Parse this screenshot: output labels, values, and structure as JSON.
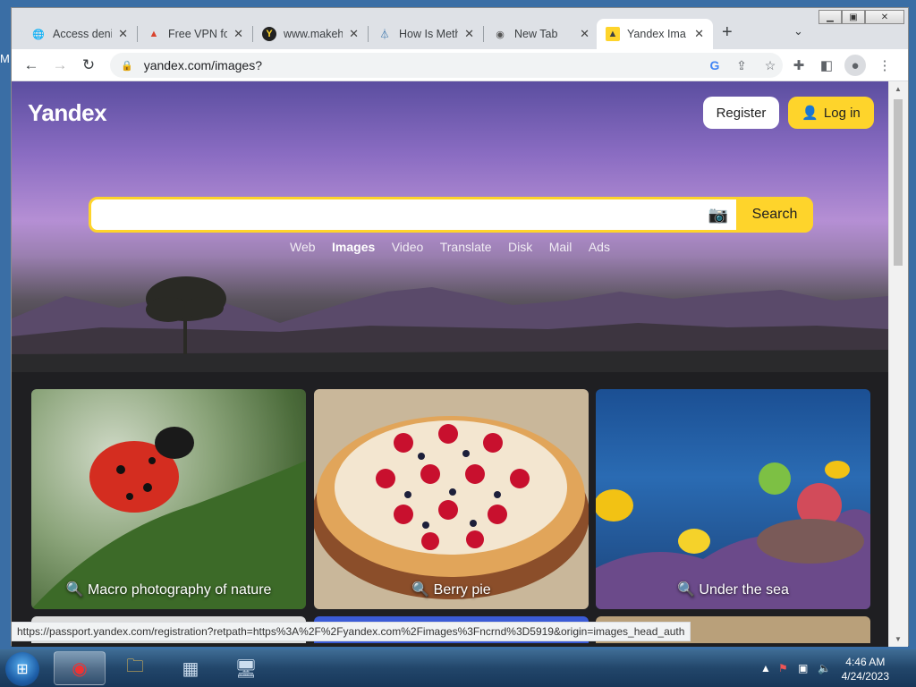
{
  "desktop": {
    "edge_label": "M"
  },
  "tabs": [
    {
      "title": "Access deni",
      "favicon": "globe-icon"
    },
    {
      "title": "Free VPN fo",
      "favicon": "vpn-icon"
    },
    {
      "title": "www.makeh",
      "favicon": "y-icon"
    },
    {
      "title": "How Is Meth",
      "favicon": "flask-icon"
    },
    {
      "title": "New Tab",
      "favicon": "chrome-icon"
    },
    {
      "title": "Yandex Ima",
      "favicon": "image-icon"
    }
  ],
  "omnibox": {
    "url": "yandex.com/images?"
  },
  "page": {
    "logo": "Yandex",
    "register_label": "Register",
    "login_label": "Log in",
    "search": {
      "placeholder": "",
      "button_label": "Search"
    },
    "services": [
      "Web",
      "Images",
      "Video",
      "Translate",
      "Disk",
      "Mail",
      "Ads"
    ],
    "active_service": "Images",
    "cards": [
      {
        "caption": "Macro photography of nature"
      },
      {
        "caption": "Berry pie"
      },
      {
        "caption": "Under the sea"
      }
    ]
  },
  "status_url": "https://passport.yandex.com/registration?retpath=https%3A%2F%2Fyandex.com%2Fimages%3Fncrnd%3D5919&origin=images_head_auth",
  "taskbar": {
    "time": "4:46 AM",
    "date": "4/24/2023"
  }
}
